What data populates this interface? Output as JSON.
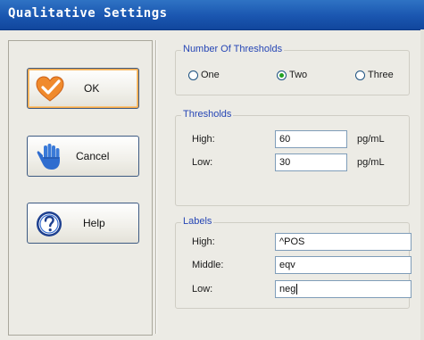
{
  "window": {
    "title": "Qualitative Settings"
  },
  "buttons": {
    "ok": "OK",
    "cancel": "Cancel",
    "help": "Help"
  },
  "thresholds_count": {
    "legend": "Number Of Thresholds",
    "options": [
      "One",
      "Two",
      "Three"
    ],
    "selected": "Two"
  },
  "thresholds": {
    "legend": "Thresholds",
    "high_label": "High:",
    "high_value": "60",
    "low_label": "Low:",
    "low_value": "30",
    "unit": "pg/mL"
  },
  "labels": {
    "legend": "Labels",
    "high_label": "High:",
    "high_value": "^POS",
    "middle_label": "Middle:",
    "middle_value": "eqv",
    "low_label": "Low:",
    "low_value": "neg"
  },
  "colors": {
    "title_bar": "#1a56b0",
    "legend_text": "#2646b5",
    "radio_selected": "#21a121"
  },
  "icons": {
    "ok": "checkmark-heart-icon",
    "cancel": "stop-hand-icon",
    "help": "question-circle-icon"
  }
}
